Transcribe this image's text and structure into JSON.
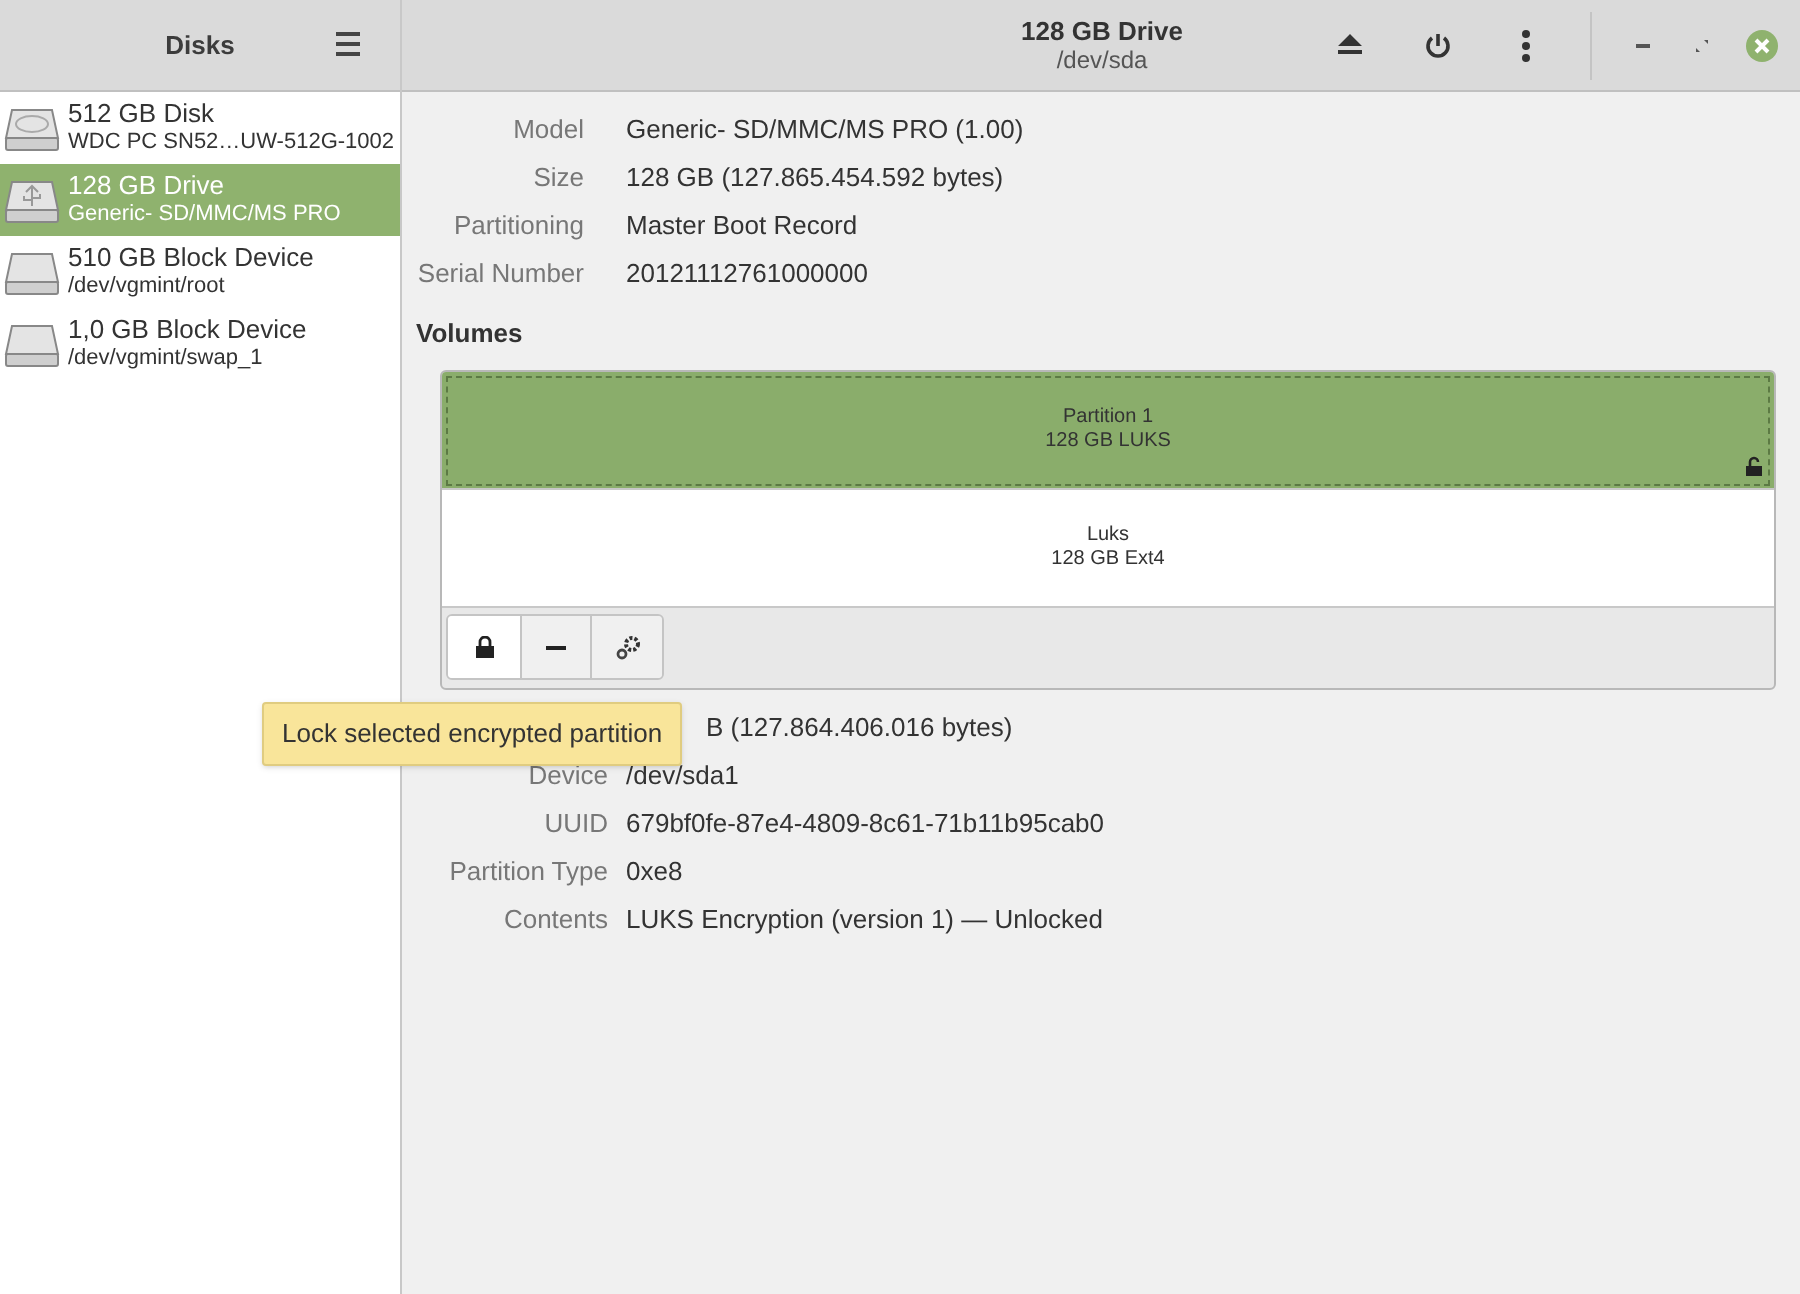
{
  "sidebar": {
    "title": "Disks",
    "items": [
      {
        "name": "512 GB Disk",
        "detail": "WDC PC SN52…UW-512G-1002",
        "kind": "hdd",
        "selected": false
      },
      {
        "name": "128 GB Drive",
        "detail": "Generic- SD/MMC/MS PRO",
        "kind": "usb",
        "selected": true
      },
      {
        "name": "510 GB Block Device",
        "detail": "/dev/vgmint/root",
        "kind": "block",
        "selected": false
      },
      {
        "name": "1,0 GB Block Device",
        "detail": "/dev/vgmint/swap_1",
        "kind": "block",
        "selected": false
      }
    ]
  },
  "header": {
    "title": "128 GB Drive",
    "subtitle": "/dev/sda"
  },
  "drive_properties": [
    {
      "label": "Model",
      "value": "Generic- SD/MMC/MS PRO (1.00)"
    },
    {
      "label": "Size",
      "value": "128 GB (127.865.454.592 bytes)"
    },
    {
      "label": "Partitioning",
      "value": "Master Boot Record"
    },
    {
      "label": "Serial Number",
      "value": "20121112761000000"
    }
  ],
  "volumes": {
    "heading": "Volumes",
    "blocks": [
      {
        "name": "Partition 1",
        "detail": "128 GB LUKS",
        "selected": true,
        "unlocked": true
      },
      {
        "name": "Luks",
        "detail": "128 GB Ext4",
        "selected": false,
        "unlocked": false
      }
    ]
  },
  "tooltip": "Lock selected encrypted partition",
  "volume_properties": [
    {
      "value": "B (127.864.406.016 bytes)"
    },
    {
      "label": "Device",
      "value": "/dev/sda1"
    },
    {
      "label": "UUID",
      "value": "679bf0fe-87e4-4809-8c61-71b11b95cab0"
    },
    {
      "label": "Partition Type",
      "value": "0xe8"
    },
    {
      "label": "Contents",
      "value": "LUKS Encryption (version 1) — Unlocked"
    }
  ]
}
